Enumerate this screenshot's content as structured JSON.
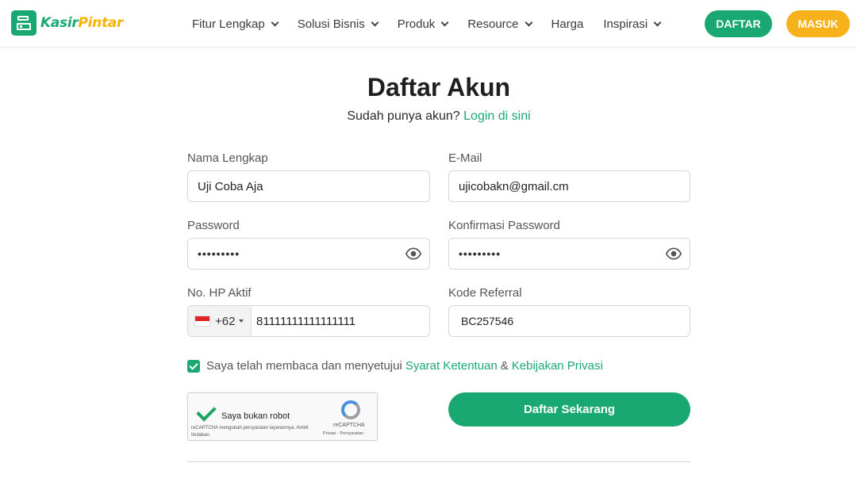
{
  "brand": {
    "part1": "Kasir",
    "part2": "Pintar",
    "color_primary": "#1aa872",
    "color_accent": "#f4b400"
  },
  "nav": {
    "items": [
      {
        "label": "Fitur Lengkap",
        "has_dropdown": true
      },
      {
        "label": "Solusi Bisnis",
        "has_dropdown": true
      },
      {
        "label": "Produk",
        "has_dropdown": true
      },
      {
        "label": "Resource",
        "has_dropdown": true
      },
      {
        "label": "Harga",
        "has_dropdown": false
      },
      {
        "label": "Inspirasi",
        "has_dropdown": true
      }
    ],
    "daftar_label": "DAFTAR",
    "masuk_label": "MASUK"
  },
  "page": {
    "title": "Daftar Akun",
    "subtitle_text": "Sudah punya akun?",
    "subtitle_link": "Login di sini"
  },
  "form": {
    "name_label": "Nama Lengkap",
    "name_value": "Uji Coba Aja",
    "email_label": "E-Mail",
    "email_value": "ujicobakn@gmail.cm",
    "password_label": "Password",
    "password_value": "•••••••••",
    "confirm_label": "Konfirmasi Password",
    "confirm_value": "•••••••••",
    "phone_label": "No. HP Aktif",
    "phone_country_code": "+62",
    "phone_value": "81111111111111111",
    "referral_label": "Kode Referral",
    "referral_value": "BC257546",
    "agree_text": "Saya telah membaca dan menyetujui",
    "agree_link1": "Syarat Ketentuan",
    "agree_amp": "&",
    "agree_link2": "Kebijakan Privasi",
    "agree_checked": true,
    "submit_label": "Daftar Sekarang"
  },
  "recaptcha": {
    "label": "Saya bukan robot",
    "terms": "reCAPTCHA mengubah persyaratan layanannya. Ambil tindakan.",
    "brand": "reCAPTCHA",
    "links": "Privasi - Persyaratan"
  }
}
